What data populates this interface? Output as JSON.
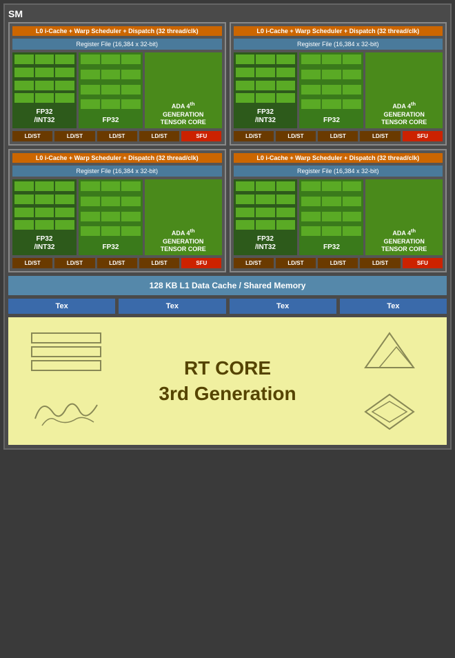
{
  "title": "SM",
  "quadrants": [
    {
      "l0": "L0 i-Cache + Warp Scheduler + Dispatch (32 thread/clk)",
      "regFile": "Register File (16,384 x 32-bit)",
      "col1Label": "FP32\n/\nINT32",
      "col2Label": "FP32",
      "col3Label": "ADA 4th\nGENERATION\nTENSOR CORE",
      "ldst": [
        "LD/ST",
        "LD/ST",
        "LD/ST",
        "LD/ST"
      ],
      "sfu": "SFU"
    },
    {
      "l0": "L0 i-Cache + Warp Scheduler + Dispatch (32 thread/clk)",
      "regFile": "Register File (16,384 x 32-bit)",
      "col1Label": "FP32\n/\nINT32",
      "col2Label": "FP32",
      "col3Label": "ADA 4th\nGENERATION\nTENSOR CORE",
      "ldst": [
        "LD/ST",
        "LD/ST",
        "LD/ST",
        "LD/ST"
      ],
      "sfu": "SFU"
    },
    {
      "l0": "L0 i-Cache + Warp Scheduler + Dispatch (32 thread/clk)",
      "regFile": "Register File (16,384 x 32-bit)",
      "col1Label": "FP32\n/\nINT32",
      "col2Label": "FP32",
      "col3Label": "ADA 4th\nGENERATION\nTENSOR CORE",
      "ldst": [
        "LD/ST",
        "LD/ST",
        "LD/ST",
        "LD/ST"
      ],
      "sfu": "SFU"
    },
    {
      "l0": "L0 i-Cache + Warp Scheduler + Dispatch (32 thread/clk)",
      "regFile": "Register File (16,384 x 32-bit)",
      "col1Label": "FP32\n/\nINT32",
      "col2Label": "FP32",
      "col3Label": "ADA 4th\nGENERATION\nTENSOR CORE",
      "ldst": [
        "LD/ST",
        "LD/ST",
        "LD/ST",
        "LD/ST"
      ],
      "sfu": "SFU"
    }
  ],
  "l1Cache": "128 KB L1 Data Cache / Shared Memory",
  "texLabels": [
    "Tex",
    "Tex",
    "Tex",
    "Tex"
  ],
  "rtCore": {
    "line1": "RT CORE",
    "line2": "3rd Generation"
  }
}
